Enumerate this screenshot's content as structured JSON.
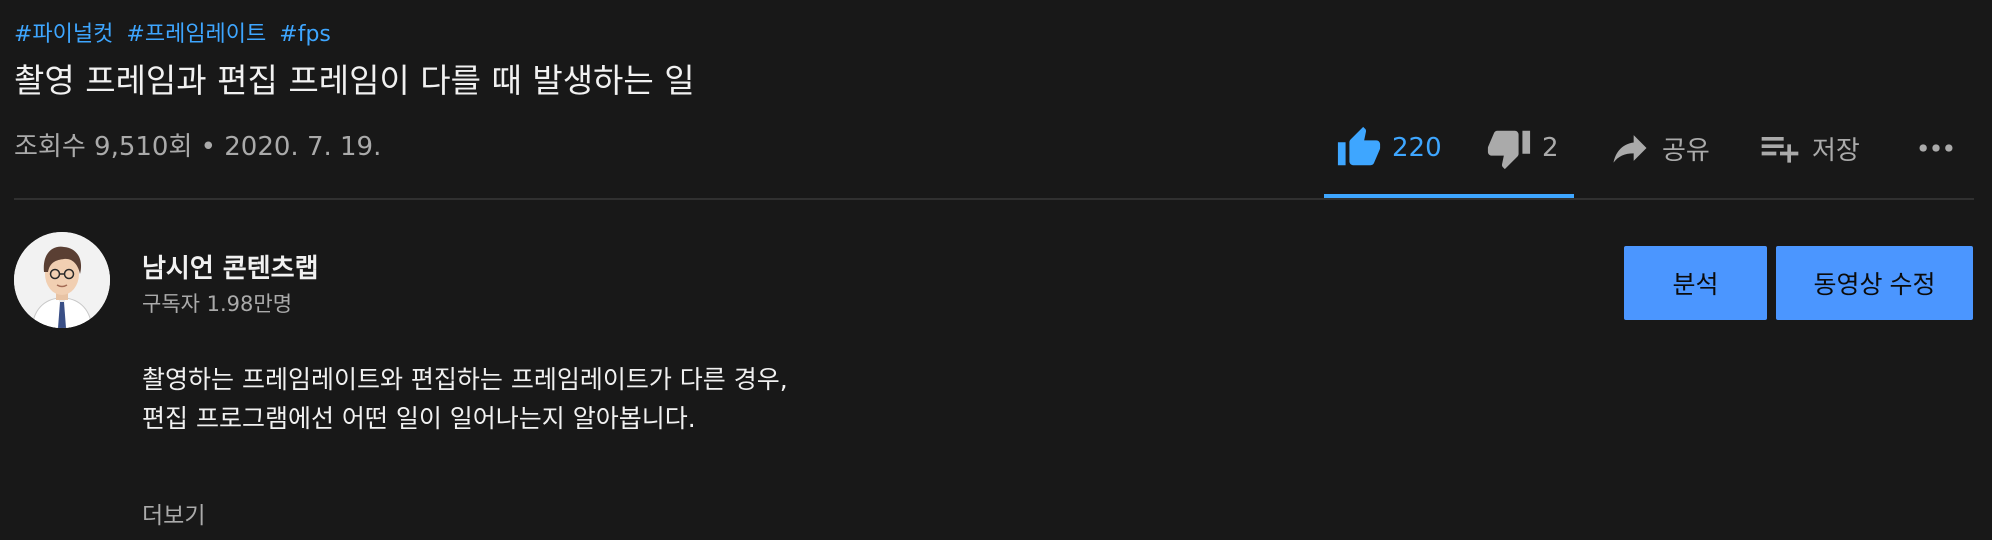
{
  "hashtags": [
    "#파이널컷",
    "#프레임레이트",
    "#fps"
  ],
  "video": {
    "title": "촬영 프레임과 편집 프레임이 다를 때 발생하는 일",
    "meta": "조회수 9,510회 • 2020. 7. 19."
  },
  "actions": {
    "like_count": "220",
    "dislike_count": "2",
    "share_label": "공유",
    "save_label": "저장"
  },
  "channel": {
    "name": "남시언 콘텐츠랩",
    "subscribers": "구독자 1.98만명"
  },
  "buttons": {
    "analytics": "분석",
    "edit_video": "동영상 수정"
  },
  "description": {
    "lines": [
      "촬영하는 프레임레이트와 편집하는 프레임레이트가 다른 경우,",
      "편집 프로그램에선 어떤 일이 일어나는지 알아봅니다."
    ],
    "show_more": "더보기"
  },
  "colors": {
    "background": "#181818",
    "accent": "#3ea6ff",
    "button": "#4b96ff",
    "primary_text": "#f1f1f1",
    "secondary_text": "#aaaaaa",
    "divider": "#303030"
  },
  "icons": [
    "thumb-up-icon",
    "thumb-down-icon",
    "share-icon",
    "playlist-add-icon",
    "more-icon"
  ]
}
